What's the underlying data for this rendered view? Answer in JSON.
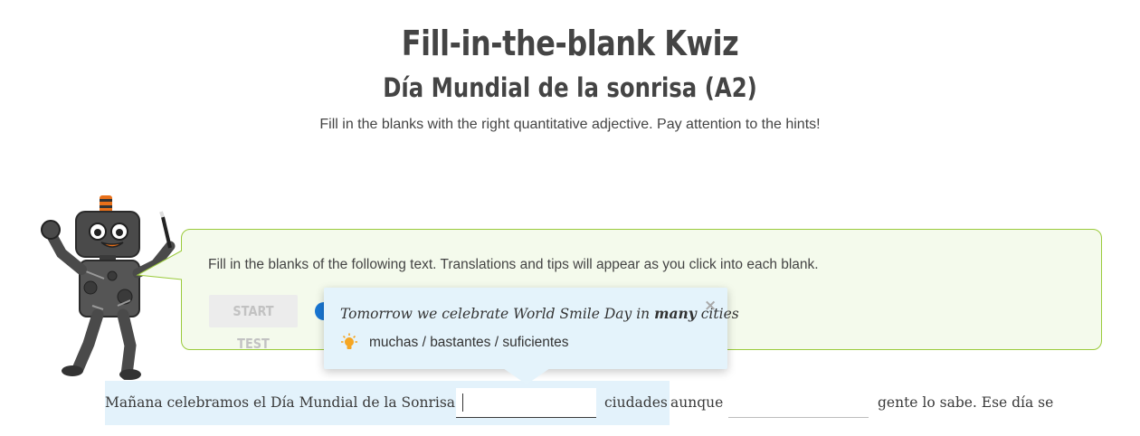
{
  "header": {
    "title": "Fill-in-the-blank Kwiz",
    "subtitle": "Día Mundial de la sonrisa (A2)",
    "instructions": "Fill in the blanks with the right quantitative adjective. Pay attention to the hints!"
  },
  "panel": {
    "text": "Fill in the blanks of the following text. Translations and tips will appear as you click into each blank.",
    "start_button": "START TEST"
  },
  "tooltip": {
    "translation_before": "Tomorrow we celebrate World Smile Day in ",
    "translation_bold": "many",
    "translation_after": " cities",
    "hint_icon": "lightbulb-icon",
    "hint": "muchas / bastantes / suficientes",
    "close": "×"
  },
  "exercise": {
    "segment1": "Mañana celebramos el Día Mundial de la Sonrisa en",
    "blank1_value": "",
    "segment2": "ciudades",
    "segment3": "aunque",
    "blank2_value": "",
    "segment4": "gente lo sabe.  Ese día se"
  },
  "colors": {
    "panel_border": "#9bcb3c",
    "panel_bg": "#f4faec",
    "tooltip_bg": "#e4f3fb",
    "toggle": "#1976d2",
    "bulb": "#f5a623"
  }
}
